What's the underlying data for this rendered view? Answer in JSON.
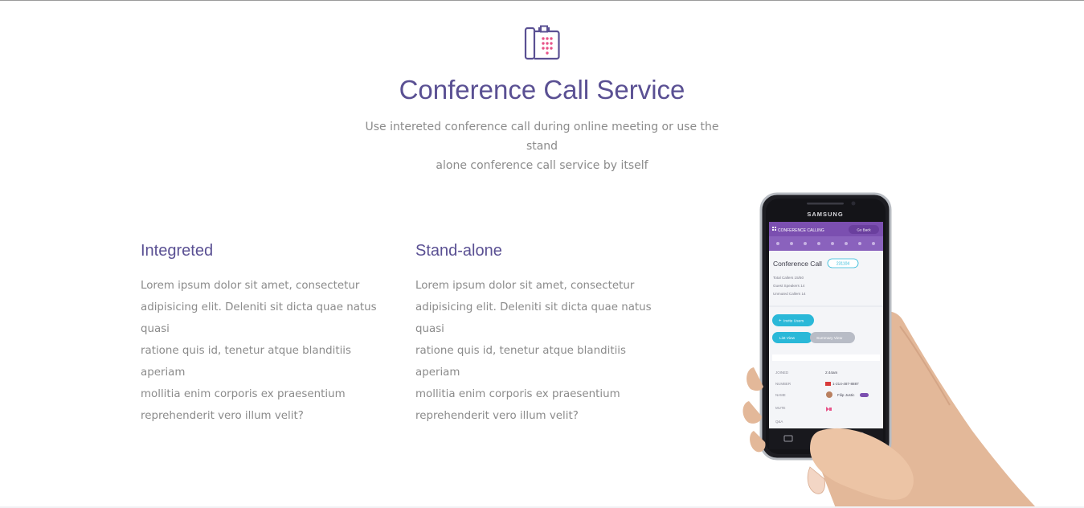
{
  "header": {
    "icon": "phone-icon",
    "title": "Conference Call Service",
    "subtitle_line1": "Use intereted conference call during online meeting or use the stand",
    "subtitle_line2": "alone conference call service by itself"
  },
  "features": [
    {
      "title": "Integreted",
      "lines": [
        "Lorem ipsum dolor sit amet, consectetur",
        "adipisicing elit. Deleniti sit dicta quae natus quasi",
        "ratione quis id, tenetur atque blanditiis aperiam",
        "mollitia enim corporis ex praesentium",
        "reprehenderit vero illum velit?"
      ]
    },
    {
      "title": "Stand-alone",
      "lines": [
        "Lorem ipsum dolor sit amet, consectetur",
        "adipisicing elit. Deleniti sit dicta quae natus quasi",
        "ratione quis id, tenetur atque blanditiis aperiam",
        "mollitia enim corporis ex praesentium",
        "reprehenderit vero illum velit?"
      ]
    }
  ],
  "phone": {
    "brand": "SAMSUNG",
    "app_header": "CONFERENCE CALLING",
    "go_back": "Go Back",
    "screen_title": "Conference Call",
    "call_id": "231104",
    "stats": [
      "Total Callers  15/50",
      "Guest Speakers  14",
      "Unmuted Callers  14"
    ],
    "invite_button": "Invite Users",
    "list_view": "List View",
    "summary_view": "Summary View",
    "rows": [
      {
        "label": "JOINED",
        "value": "2:44am"
      },
      {
        "label": "NUMBER",
        "value": "1-214-487-8887"
      },
      {
        "label": "NAME",
        "value": "Filip Justic"
      },
      {
        "label": "MUTE",
        "value": ""
      },
      {
        "label": "Q&A",
        "value": ""
      }
    ]
  },
  "colors": {
    "title": "#5a5093",
    "body_text": "#8b8b8b",
    "accent_pink": "#e8558a",
    "app_purple": "#7b4fb0",
    "app_teal": "#2ab8d8"
  }
}
